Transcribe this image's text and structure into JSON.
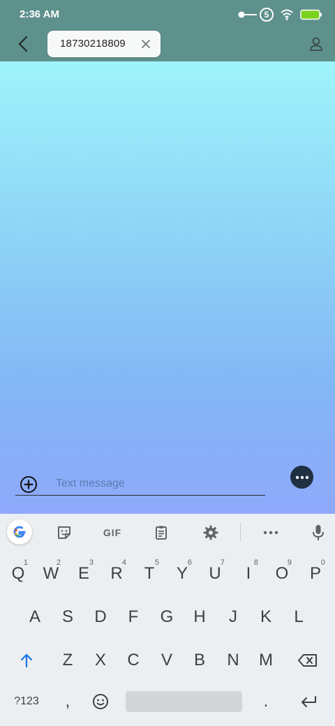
{
  "status_bar": {
    "time": "2:36 AM",
    "icons": [
      "key-icon",
      "data-saver-5-icon",
      "wifi-icon",
      "battery-icon"
    ],
    "badge": "5",
    "battery_color": "#7ad21f"
  },
  "app_bar": {
    "recipient": "18730218809",
    "back_icon": "back-arrow-icon",
    "clear_icon": "close-icon",
    "contact_icon": "person-icon"
  },
  "compose": {
    "placeholder": "Text message",
    "value": "",
    "add_icon": "add-circle-icon",
    "more_icon": "more-options-icon"
  },
  "colors": {
    "header": "#5f918c",
    "gradient_top": "#9ff4fb",
    "gradient_bottom": "#8ea9fb",
    "more_button": "#1f3042",
    "keyboard_bg": "#eceff1"
  },
  "keyboard": {
    "toolbar": {
      "gif_label": "GIF",
      "icons": [
        "google-icon",
        "sticker-icon",
        "gif-icon",
        "clipboard-icon",
        "settings-icon",
        "more-icon",
        "mic-icon"
      ]
    },
    "row1": [
      "Q",
      "W",
      "E",
      "R",
      "T",
      "Y",
      "U",
      "I",
      "O",
      "P"
    ],
    "row1_hints": [
      "1",
      "2",
      "3",
      "4",
      "5",
      "6",
      "7",
      "8",
      "9",
      "0"
    ],
    "row2": [
      "A",
      "S",
      "D",
      "F",
      "G",
      "H",
      "J",
      "K",
      "L"
    ],
    "row3": [
      "Z",
      "X",
      "C",
      "V",
      "B",
      "N",
      "M"
    ],
    "bottom": {
      "symbols": "?123",
      "comma": ",",
      "period": "."
    }
  }
}
